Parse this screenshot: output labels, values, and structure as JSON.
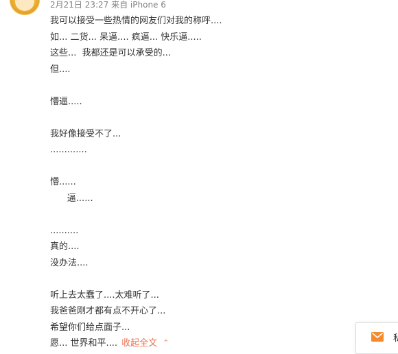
{
  "post": {
    "meta": "2月21日 23:27 来自 iPhone 6",
    "lines": [
      "我可以接受一些热情的网友们对我的称呼....",
      "如... 二货... 呆逼.... 疯逼... 快乐逼.....",
      "这些...  我都还是可以承受的...",
      "但....",
      "",
      "懵逼.....",
      "",
      "我好像接受不了...",
      ".............",
      "",
      "懵......",
      "      逼......",
      "",
      "..........",
      "真的....",
      "没办法....",
      "",
      "听上去太蠢了....太难听了...",
      "我爸爸刚才都有点不开心了...",
      "希望你们给点面子...",
      "愿... 世界和平...."
    ],
    "collapse_label": "收起全文",
    "collapse_icon": "chevron-up-icon"
  },
  "side_widget": {
    "label": "私",
    "icon": "mail-icon",
    "icon_color": "#f68b2c"
  }
}
